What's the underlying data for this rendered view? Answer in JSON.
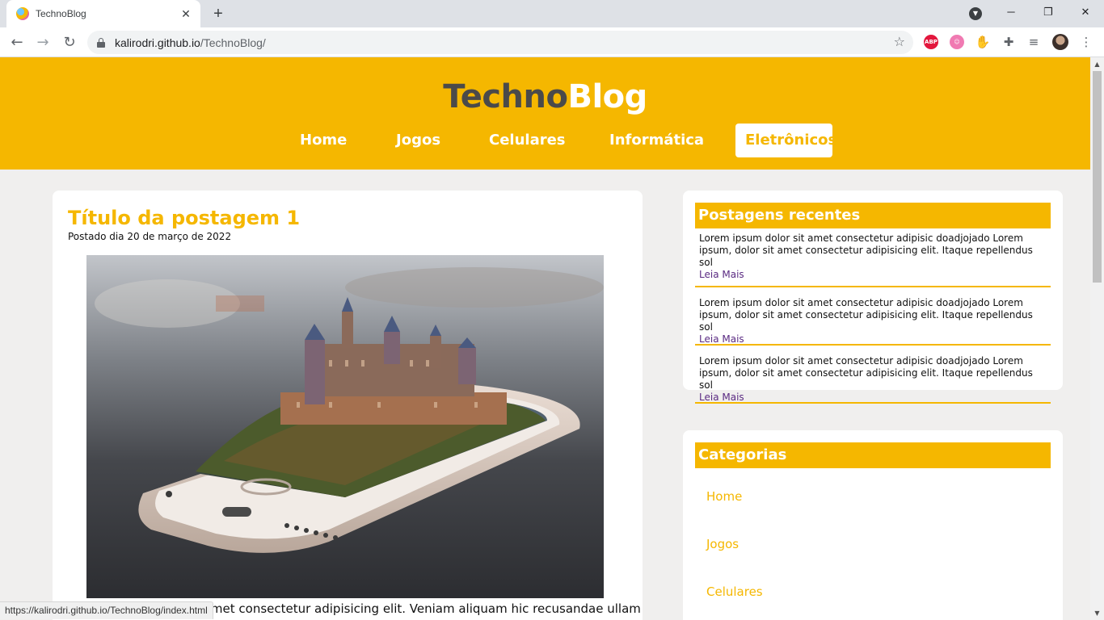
{
  "browser": {
    "tab_title": "TechnoBlog",
    "tab_close": "✕",
    "new_tab": "+",
    "url_host": "kalirodri.github.io",
    "url_path": "/TechnoBlog/",
    "status_url": "https://kalirodri.github.io/TechnoBlog/index.html",
    "extensions": [
      "abp-icon",
      "avatar-extension-icon",
      "hand-icon",
      "puzzle-icon",
      "reading-list-icon",
      "profile-avatar"
    ]
  },
  "site": {
    "logo_part1": "Techno",
    "logo_part2": "Blog",
    "menu": [
      "Home",
      "Jogos",
      "Celulares",
      "Informática",
      "Eletrônicos"
    ],
    "active_menu": "Eletrônicos",
    "colors": {
      "accent": "#f5b700",
      "dark": "#4a4a4a",
      "background": "#f0efee",
      "link": "#5a2a82"
    }
  },
  "post": {
    "title": "Título da postagem 1",
    "date": "Postado dia 20 de março de 2022",
    "text": "Lorem ipsum dolor sit amet consectetur adipisicing elit. Veniam aliquam hic recusandae ullam"
  },
  "recent": {
    "title": "Postagens recentes",
    "items": [
      {
        "text": "Lorem ipsum dolor sit amet consectetur adipisic doadjojado Lorem ipsum, dolor sit amet consectetur adipisicing elit. Itaque repellendus sol",
        "link": "Leia Mais"
      },
      {
        "text": "Lorem ipsum dolor sit amet consectetur adipisic doadjojado Lorem ipsum, dolor sit amet consectetur adipisicing elit. Itaque repellendus sol",
        "link": "Leia Mais"
      },
      {
        "text": "Lorem ipsum dolor sit amet consectetur adipisic doadjojado Lorem ipsum, dolor sit amet consectetur adipisicing elit. Itaque repellendus sol",
        "link": "Leia Mais"
      }
    ]
  },
  "categories": {
    "title": "Categorias",
    "items": [
      "Home",
      "Jogos",
      "Celulares"
    ]
  }
}
